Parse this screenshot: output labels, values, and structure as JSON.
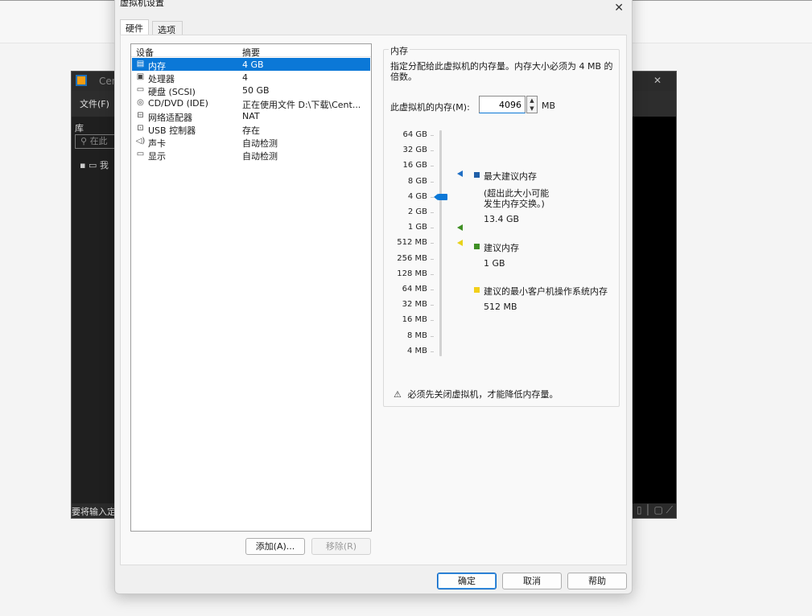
{
  "background": {
    "window_title": "Cen",
    "menu_file": "文件(F)",
    "library_title": "库",
    "search_placeholder": "在此",
    "tree_item": "我",
    "status_text": "要将输入定"
  },
  "dialog": {
    "title": "虚拟机设置",
    "tabs": [
      "硬件",
      "选项"
    ],
    "device_list": {
      "headers": [
        "设备",
        "摘要"
      ],
      "items": [
        {
          "icon": "memory-icon",
          "name": "内存",
          "summary": "4 GB",
          "selected": true
        },
        {
          "icon": "cpu-icon",
          "name": "处理器",
          "summary": "4",
          "selected": false
        },
        {
          "icon": "hard-disk-icon",
          "name": "硬盘 (SCSI)",
          "summary": "50 GB",
          "selected": false
        },
        {
          "icon": "cd-dvd-icon",
          "name": "CD/DVD (IDE)",
          "summary": "正在使用文件 D:\\下载\\Cent...",
          "selected": false
        },
        {
          "icon": "network-adapter-icon",
          "name": "网络适配器",
          "summary": "NAT",
          "selected": false
        },
        {
          "icon": "usb-icon",
          "name": "USB 控制器",
          "summary": "存在",
          "selected": false
        },
        {
          "icon": "sound-icon",
          "name": "声卡",
          "summary": "自动检测",
          "selected": false
        },
        {
          "icon": "display-icon",
          "name": "显示",
          "summary": "自动检测",
          "selected": false
        }
      ]
    },
    "add_button": "添加(A)...",
    "remove_button": "移除(R)",
    "memory": {
      "group_title": "内存",
      "description": "指定分配给此虚拟机的内存量。内存大小必须为 4 MB 的倍数。",
      "input_label": "此虚拟机的内存(M):",
      "input_value": "4096",
      "unit": "MB",
      "scale_labels": [
        "64 GB",
        "32 GB",
        "16 GB",
        "8 GB",
        "4 GB",
        "2 GB",
        "1 GB",
        "512 MB",
        "256 MB",
        "128 MB",
        "64 MB",
        "32 MB",
        "16 MB",
        "8 MB",
        "4 MB"
      ],
      "slider_level_index": 4,
      "markers": [
        {
          "color": "#1f6fc5",
          "level_index": 2.5
        },
        {
          "color": "#3f8f24",
          "level_index": 6.0
        },
        {
          "color": "#e8d21a",
          "level_index": 7.0
        }
      ],
      "legend": [
        {
          "color": "#1f5fa8",
          "title": "最大建议内存",
          "note1": "(超出此大小可能",
          "note2": "发生内存交换。)",
          "value": "13.4 GB"
        },
        {
          "color": "#3f8f24",
          "title": "建议内存",
          "value": "1 GB"
        },
        {
          "color": "#f2cf1a",
          "title": "建议的最小客户机操作系统内存",
          "value": "512 MB"
        }
      ],
      "warning": "必须先关闭虚拟机，才能降低内存量。"
    },
    "ok_button": "确定",
    "cancel_button": "取消",
    "help_button": "帮助"
  }
}
